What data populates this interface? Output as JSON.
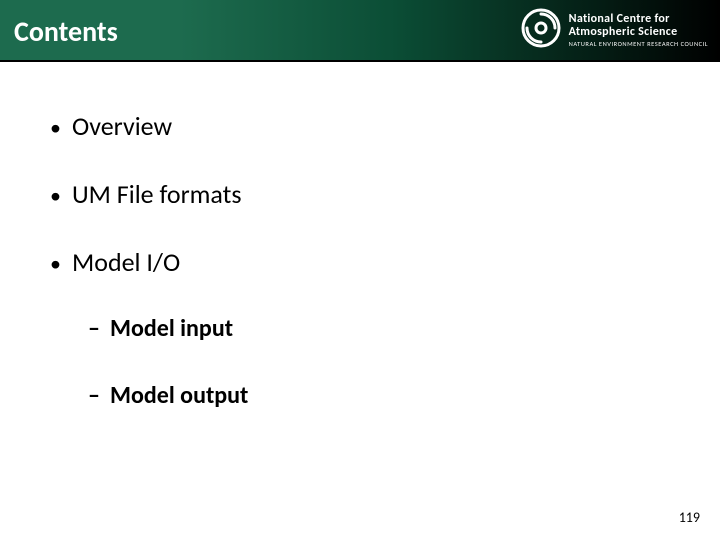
{
  "header": {
    "title": "Contents",
    "logo": {
      "name_line1": "National Centre for",
      "name_line2": "Atmospheric Science",
      "subline": "NATURAL ENVIRONMENT RESEARCH COUNCIL"
    }
  },
  "bullets": {
    "level1": [
      "Overview",
      "UM File formats",
      " Model I/O"
    ],
    "level2": [
      "Model input",
      "Model output"
    ]
  },
  "page_number": "119",
  "colors": {
    "header_green": "#1d6b4e",
    "header_dark": "#000000"
  }
}
